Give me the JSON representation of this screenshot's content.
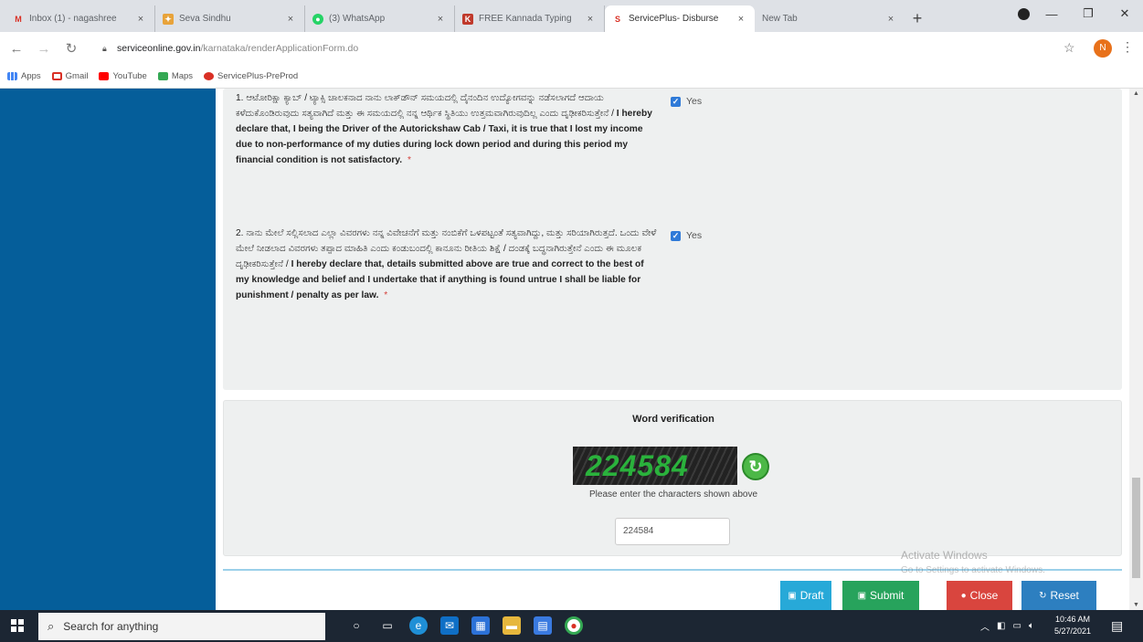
{
  "browser": {
    "tabs": [
      {
        "title": "Inbox (1) - nagashree",
        "favicon": "gmail-icon",
        "color": "#d93025"
      },
      {
        "title": "Seva Sindhu",
        "favicon": "seva-sindhu-icon",
        "color": "#e8a33a"
      },
      {
        "title": "(3) WhatsApp",
        "favicon": "whatsapp-icon",
        "color": "#25d366"
      },
      {
        "title": "FREE Kannada Typing",
        "favicon": "typing-icon",
        "color": "#c0392b"
      },
      {
        "title": "ServicePlus- Disburse",
        "favicon": "serviceplus-icon",
        "color": "#d93025",
        "active": true
      },
      {
        "title": "New Tab",
        "favicon": "",
        "color": ""
      }
    ],
    "url_host": "serviceonline.gov.in",
    "url_path": "/karnataka/renderApplicationForm.do",
    "profile_initial": "N",
    "bookmarks": [
      {
        "label": "Apps",
        "icon": "apps-grid-icon",
        "color": "#4285f4"
      },
      {
        "label": "Gmail",
        "icon": "gmail-icon",
        "color": "#d93025"
      },
      {
        "label": "YouTube",
        "icon": "youtube-icon",
        "color": "#ff0000"
      },
      {
        "label": "Maps",
        "icon": "maps-icon",
        "color": "#34a853"
      },
      {
        "label": "ServicePlus-PreProd",
        "icon": "serviceplus-icon",
        "color": "#d93025"
      }
    ]
  },
  "declarations": [
    {
      "number": "1.",
      "kannada": "ಆಟೋರಿಕ್ಷಾ ಕ್ಯಾಬ್ / ಟ್ಯಾಕ್ಸಿ ಚಾಲಕನಾದ ನಾನು ಲಾಕ್‌ಡೌನ್ ಸಮಯದಲ್ಲಿ ದೈನಂದಿನ ಉದ್ಯೋಗವನ್ನು ನಡೆಸಲಾಗದೆ ಆದಾಯ ಕಳೆದುಕೊಂಡಿರುವುದು ಸತ್ಯವಾಗಿದೆ ಮತ್ತು ಈ ಸಮಯದಲ್ಲಿ ನನ್ನ ಆರ್ಥಿಕ ಸ್ಥಿತಿಯು ಉತ್ತಮವಾಗಿರುವುದಿಲ್ಲ ಎಂದು ದೃಢೀಕರಿಸುತ್ತೇನೆ /",
      "english": "I hereby declare that, I being the Driver of the Autorickshaw Cab / Taxi, it is true that I lost my income due to non-performance of my duties during lock down period and during this period my financial condition is not satisfactory.",
      "required": "*",
      "checkbox_label": "Yes"
    },
    {
      "number": "2.",
      "kannada": "ನಾನು ಮೇಲೆ ಸಲ್ಲಿಸಲಾದ ಎಲ್ಲಾ ವಿವರಗಳು ನನ್ನ ವಿವೇಚನೆಗೆ ಮತ್ತು ನಂಬಿಕೆಗೆ ಒಳಪಟ್ಟಂತೆ ಸತ್ಯವಾಗಿದ್ದು, ಮತ್ತು ಸರಿಯಾಗಿರುತ್ತದೆ. ಒಂದು ವೇಳೆ ಮೇಲೆ ನೀಡಲಾದ ವಿವರಗಳು ತಪ್ಪಾದ ಮಾಹಿತಿ ಎಂದು ಕಂಡುಬಂದಲ್ಲಿ ಕಾನೂನು ರೀತಿಯ ಶಿಕ್ಷೆ / ದಂಡಕ್ಕೆ ಬದ್ಧನಾಗಿರುತ್ತೇನೆ ಎಂದು ಈ ಮೂಲಕ ದೃಢೀಕರಿಸುತ್ತೇನೆ /",
      "english": "I hereby declare that, details submitted above are true and correct to the best of my knowledge and belief and I undertake that if anything is found untrue I shall be liable for punishment / penalty as per law.",
      "required": "*",
      "checkbox_label": "Yes"
    }
  ],
  "verification": {
    "title": "Word verification",
    "captcha_text": "224584",
    "hint": "Please enter the characters shown above",
    "input_value": "224584"
  },
  "watermark": {
    "line1": "Activate Windows",
    "line2": "Go to Settings to activate Windows."
  },
  "buttons": {
    "draft": "Draft",
    "submit": "Submit",
    "close": "Close",
    "reset": "Reset"
  },
  "taskbar": {
    "search_placeholder": "Search for anything",
    "time": "10:46 AM",
    "date": "5/27/2021"
  }
}
